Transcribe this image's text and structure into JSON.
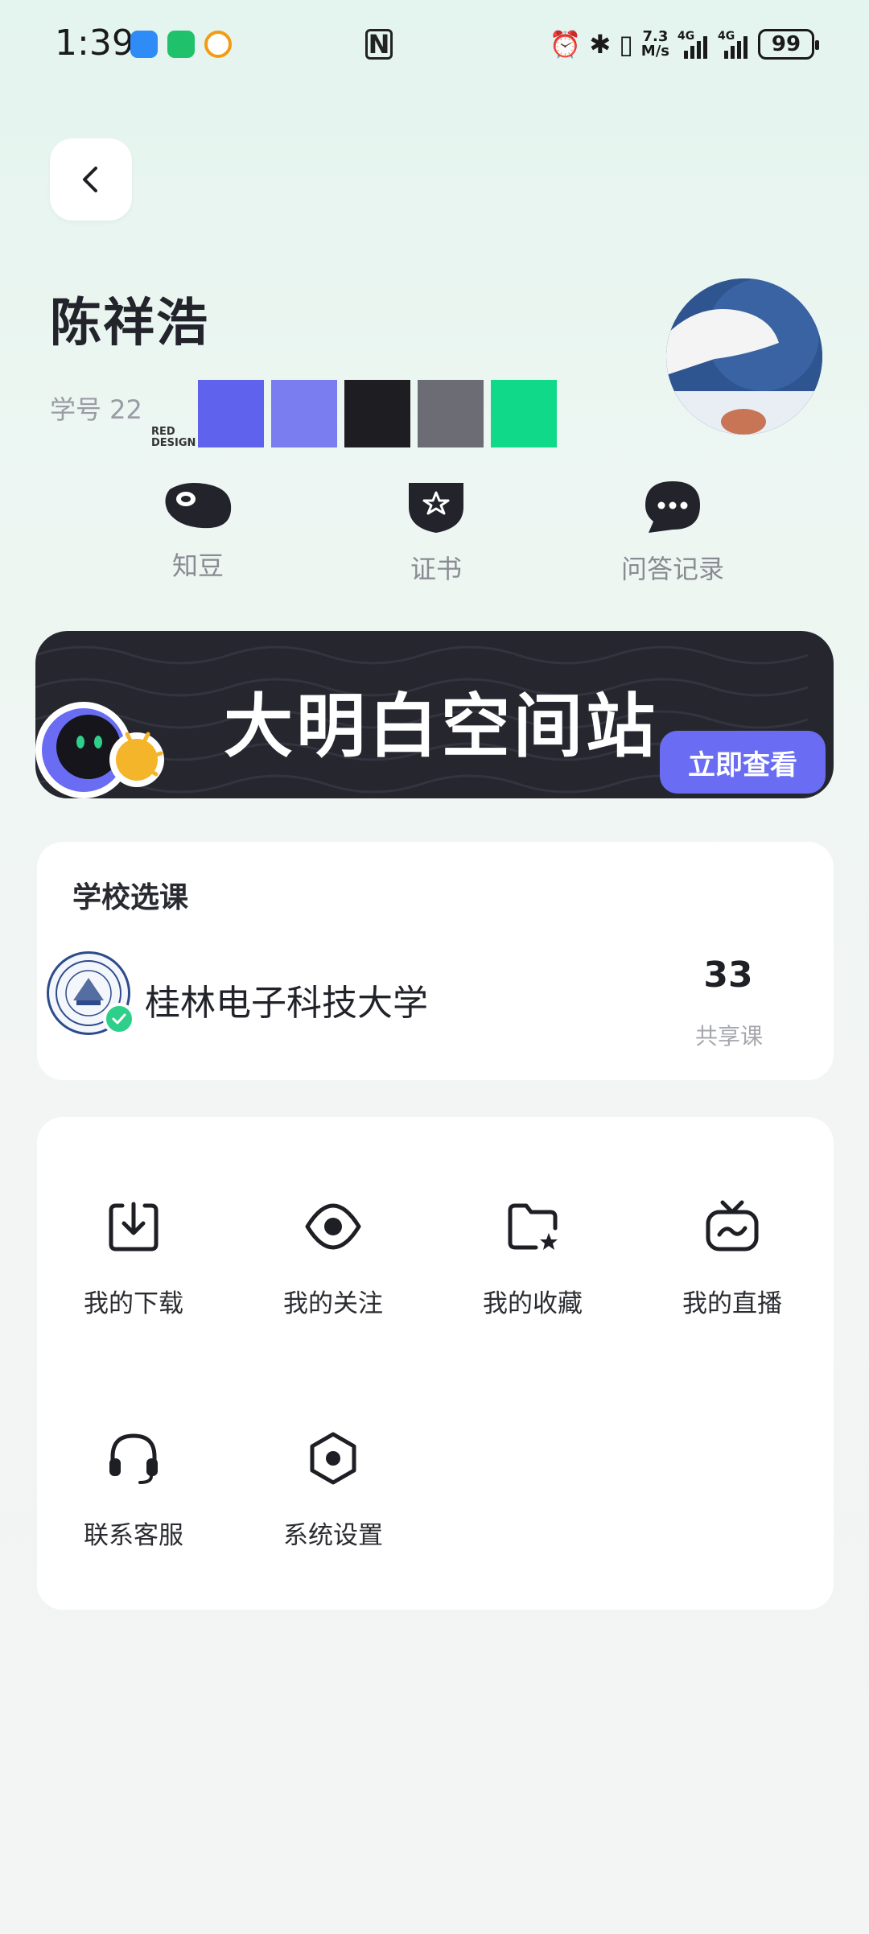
{
  "status_bar": {
    "time": "1:39",
    "speed_top": "7.3",
    "speed_bottom": "M/s",
    "net1": "4G",
    "net2": "4G",
    "battery": "99"
  },
  "profile": {
    "name": "陈祥浩",
    "student_id": "学号 22",
    "watermark": "RED DESIGN",
    "palette": [
      "#5f62ec",
      "#7a7df0",
      "#1d1d22",
      "#6c6d74",
      "#10d98a"
    ]
  },
  "quick_actions": [
    {
      "label": "知豆",
      "icon": "bean-icon"
    },
    {
      "label": "证书",
      "icon": "certificate-icon"
    },
    {
      "label": "问答记录",
      "icon": "chat-bubble-icon"
    }
  ],
  "banner": {
    "title": "大明白空间站",
    "cta": "立即查看"
  },
  "school": {
    "section_title": "学校选课",
    "name": "桂林电子科技大学",
    "shared_count": "33",
    "shared_label": "共享课"
  },
  "menu": [
    {
      "label": "我的下载",
      "icon": "download-icon"
    },
    {
      "label": "我的关注",
      "icon": "eye-icon"
    },
    {
      "label": "我的收藏",
      "icon": "folder-star-icon"
    },
    {
      "label": "我的直播",
      "icon": "tv-icon"
    },
    {
      "label": "联系客服",
      "icon": "headset-icon"
    },
    {
      "label": "系统设置",
      "icon": "hexagon-settings-icon"
    }
  ],
  "colors": {
    "accent": "#6a6df3",
    "banner_bg": "#26262f",
    "verified": "#2ecf8a"
  }
}
